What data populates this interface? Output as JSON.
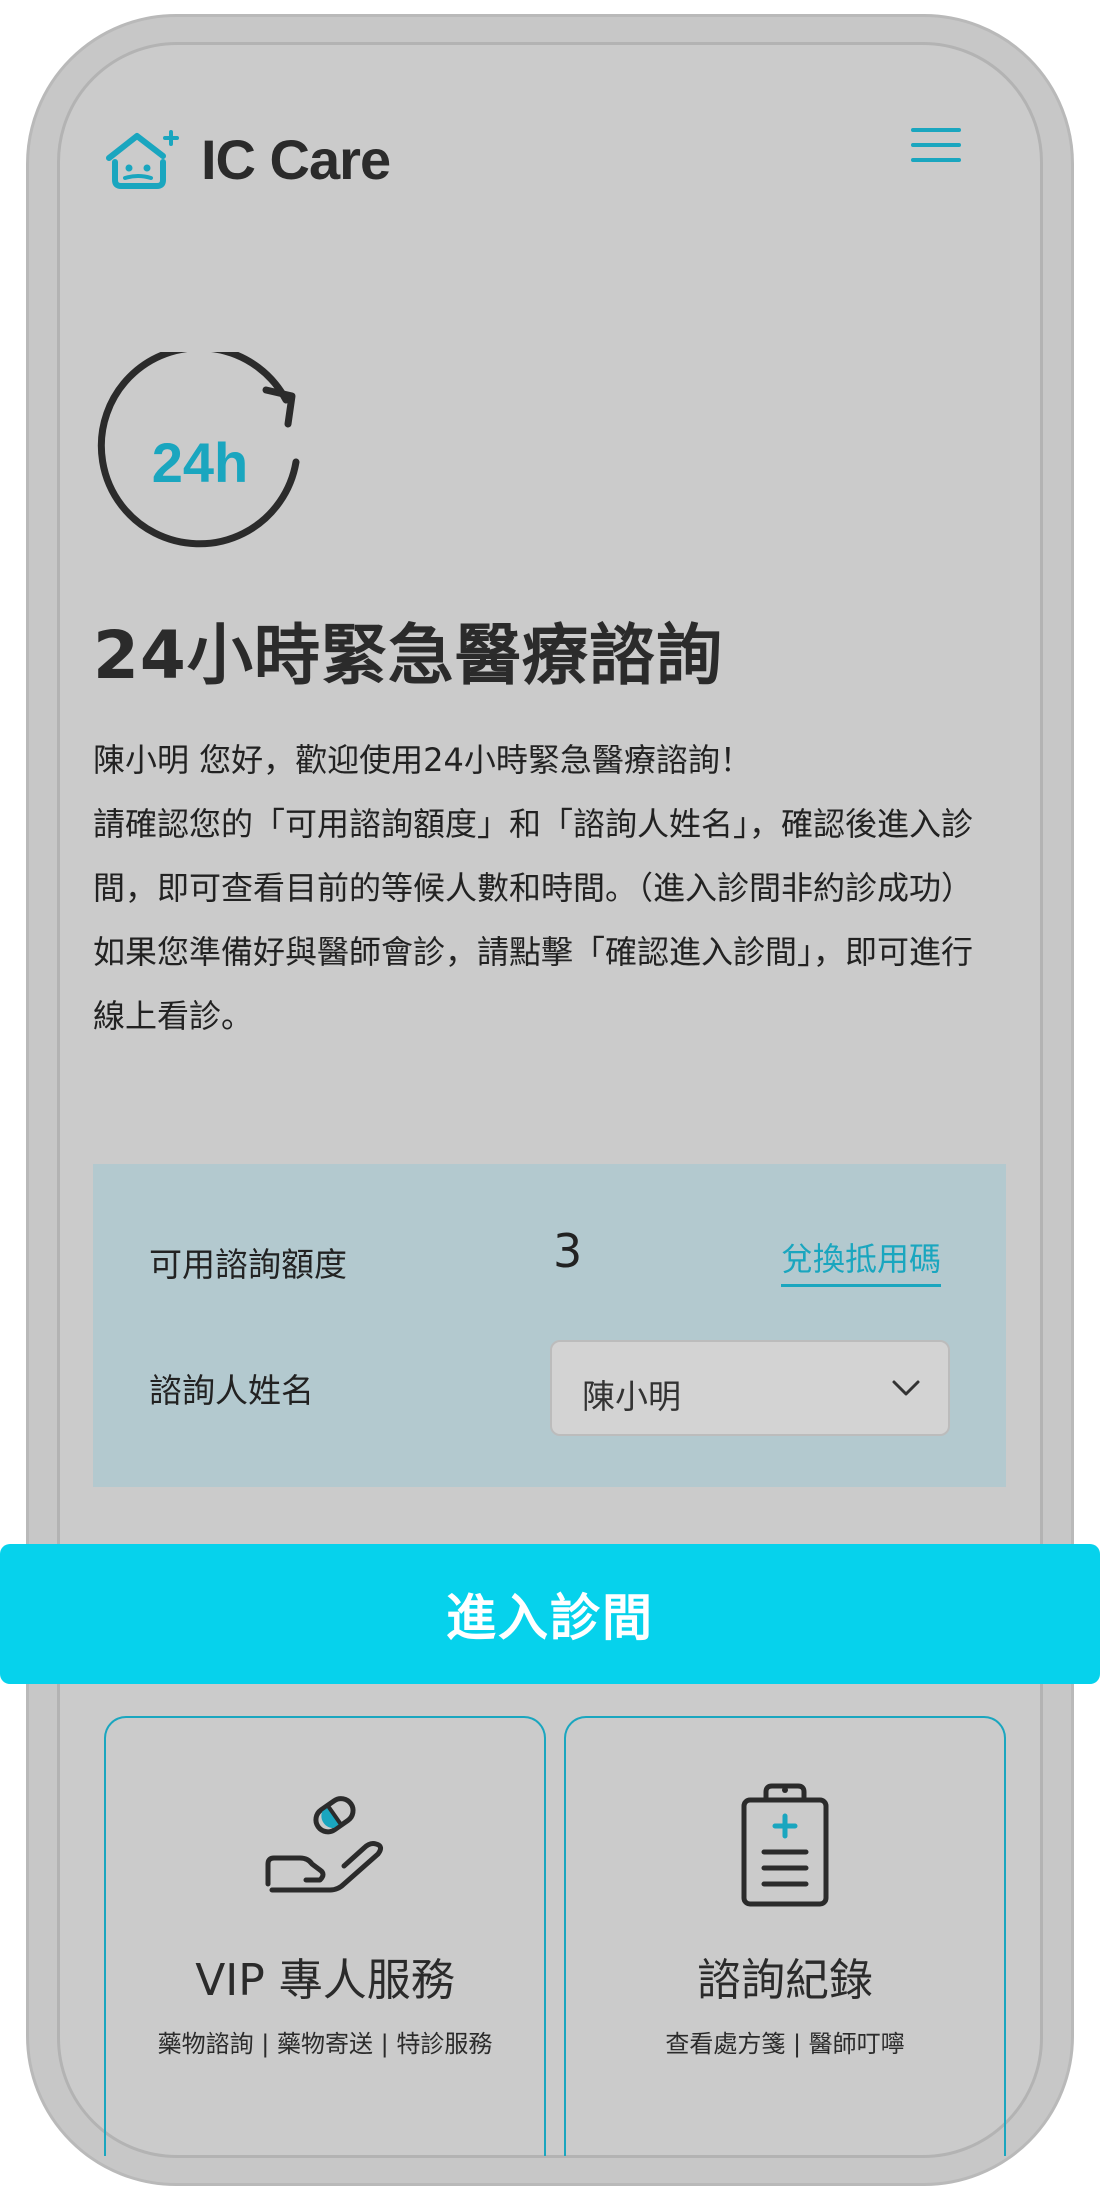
{
  "brand": {
    "name": "IC Care",
    "accent": "#1aa6bf",
    "button_color": "#06d2ec"
  },
  "hero": {
    "icon_text": "24h",
    "title": "24小時緊急醫療諮詢"
  },
  "intro": {
    "line1": "陳小明 您好，歡迎使用24小時緊急醫療諮詢！",
    "line2": "請確認您的「可用諮詢額度」和「諮詢人姓名」，確認後進入診間，即可查看目前的等候人數和時間。（進入診間非約診成功）",
    "line3": "如果您準備好與醫師會診，請點擊「確認進入診間」，即可進行線上看診。"
  },
  "form": {
    "quota_label": "可用諮詢額度",
    "quota_value": "3",
    "redeem_link": "兌換抵用碼",
    "name_label": "諮詢人姓名",
    "name_selected": "陳小明"
  },
  "enter_button": "進入診間",
  "cards": {
    "vip": {
      "icon": "pill-hand-icon",
      "title": "VIP 專人服務",
      "subtitle": "藥物諮詢 | 藥物寄送 | 特診服務"
    },
    "records": {
      "icon": "clipboard-icon",
      "title": "諮詢紀錄",
      "subtitle": "查看處方箋 | 醫師叮嚀"
    }
  }
}
